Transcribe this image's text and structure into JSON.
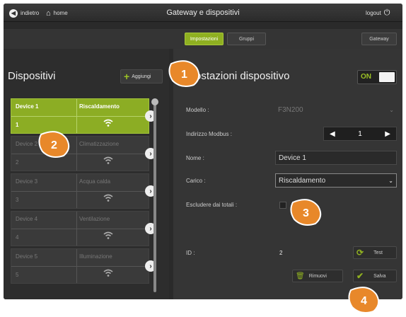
{
  "topbar": {
    "back_label": "indietro",
    "home_label": "home",
    "title": "Gateway e dispositivi",
    "logout_label": "logout"
  },
  "tabs": {
    "items": [
      {
        "label": "Impostazioni",
        "active": true
      },
      {
        "label": "Gruppi",
        "active": false
      }
    ],
    "gateway_label": "Gateway"
  },
  "devices_panel": {
    "heading": "Dispositivi",
    "add_label": "Aggiungi",
    "devices": [
      {
        "name": "Device 1",
        "load": "Riscaldamento",
        "number": "1",
        "selected": true
      },
      {
        "name": "Device 2",
        "load": "Climatizzazione",
        "number": "2",
        "selected": false
      },
      {
        "name": "Device 3",
        "load": "Acqua calda",
        "number": "3",
        "selected": false
      },
      {
        "name": "Device 4",
        "load": "Ventilazione",
        "number": "4",
        "selected": false
      },
      {
        "name": "Device 5",
        "load": "Illuminazione",
        "number": "5",
        "selected": false
      }
    ]
  },
  "settings_panel": {
    "heading": "Impostazioni dispositivo",
    "toggle_label": "ON",
    "fields": {
      "modello_label": "Modello :",
      "modello_value": "F3N200",
      "modbus_label": "Indirizzo Modbus :",
      "modbus_value": "1",
      "nome_label": "Nome :",
      "nome_value": "Device 1",
      "carico_label": "Carico :",
      "carico_value": "Riscaldamento",
      "escludere_label": "Escludere dai totali :",
      "id_label": "ID :",
      "id_value": "2"
    },
    "test_label": "Test",
    "remove_label": "Rimuovi",
    "save_label": "Salva"
  },
  "callouts": [
    "1",
    "2",
    "3",
    "4"
  ],
  "colors": {
    "accent_green": "#8fb021",
    "callout_orange": "#e8882a"
  }
}
